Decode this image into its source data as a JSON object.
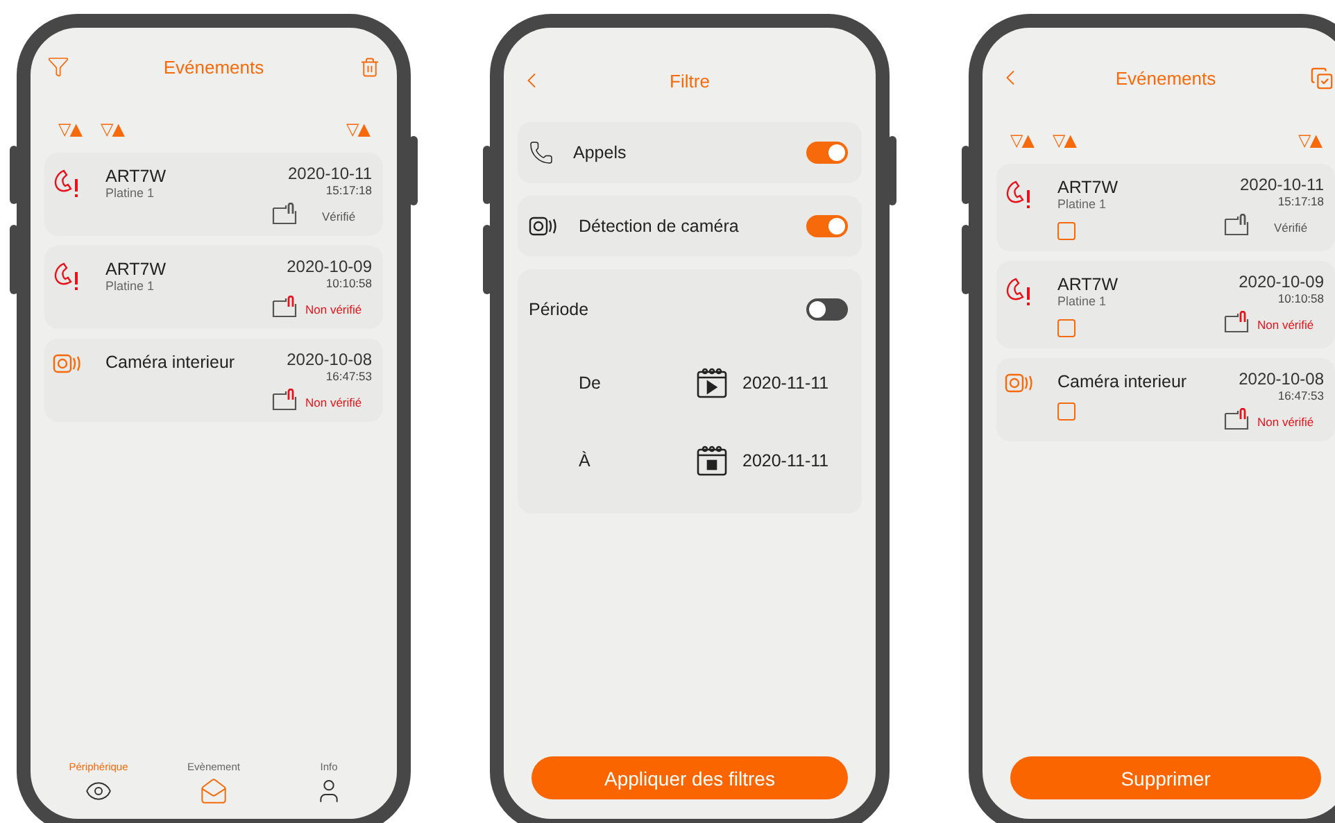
{
  "screens": [
    {
      "kind": "events",
      "title": "Evénements",
      "sort_controls": [
        "▽▲",
        "▽▲",
        "▽▲"
      ],
      "events": [
        {
          "kind": "call",
          "name": "ART7W",
          "source": "Platine 1",
          "date": "2020-10-11",
          "time": "15:17:18",
          "verified": true,
          "status": "Vérifié"
        },
        {
          "kind": "call",
          "name": "ART7W",
          "source": "Platine 1",
          "date": "2020-10-09",
          "time": "10:10:58",
          "verified": false,
          "status": "Non vérifié"
        },
        {
          "kind": "camera",
          "name": "Caméra interieur",
          "date": "2020-10-08",
          "time": "16:47:53",
          "verified": false,
          "status": "Non vérifié"
        }
      ],
      "tabs": [
        {
          "kind": "device",
          "label": "Périphérique",
          "selected": false,
          "label_highlighted": true
        },
        {
          "kind": "event",
          "label": "Evènement",
          "selected": true,
          "label_highlighted": false
        },
        {
          "kind": "info",
          "label": "Info",
          "selected": false,
          "label_highlighted": false
        }
      ]
    },
    {
      "kind": "filter",
      "title": "Filtre",
      "filters": [
        {
          "kind": "call",
          "label": "Appels",
          "on": true
        },
        {
          "kind": "camera",
          "label": "Détection de caméra",
          "on": true
        }
      ],
      "period": {
        "label": "Période",
        "on": false,
        "ranges": [
          {
            "kind": "start",
            "label": "De",
            "date": "2020-11-11"
          },
          {
            "kind": "end",
            "label": "À",
            "date": "2020-11-11"
          }
        ]
      },
      "button": "Appliquer des filtres"
    },
    {
      "kind": "select",
      "title": "Evénements",
      "sort_controls": [
        "▽▲",
        "▽▲",
        "▽▲"
      ],
      "events": [
        {
          "kind": "call",
          "name": "ART7W",
          "source": "Platine 1",
          "date": "2020-10-11",
          "time": "15:17:18",
          "verified": true,
          "status": "Vérifié",
          "checked": false
        },
        {
          "kind": "call",
          "name": "ART7W",
          "source": "Platine 1",
          "date": "2020-10-09",
          "time": "10:10:58",
          "verified": false,
          "status": "Non vérifié",
          "checked": false
        },
        {
          "kind": "camera",
          "name": "Caméra interieur",
          "date": "2020-10-08",
          "time": "16:47:53",
          "verified": false,
          "status": "Non vérifié",
          "checked": false
        }
      ],
      "button": "Supprimer"
    }
  ]
}
